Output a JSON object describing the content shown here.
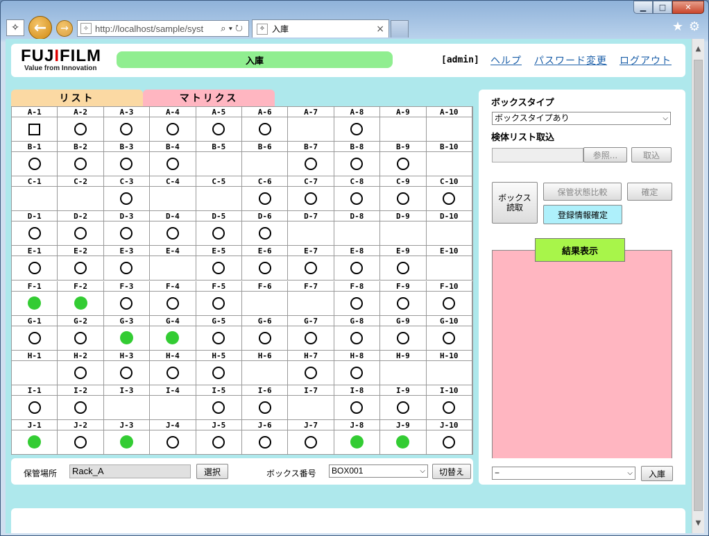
{
  "browser": {
    "url": "http://localhost/sample/syst",
    "tab_title": "入庫",
    "caption": {
      "min": "▁",
      "max": "□",
      "close": "✕"
    }
  },
  "header": {
    "logo_brand": [
      "FUJ",
      "I",
      "FILM"
    ],
    "logo_tagline": "Value from Innovation",
    "title": "入庫",
    "user": "[admin]",
    "links": [
      "ヘルプ",
      "パスワード変更",
      "ログアウト"
    ]
  },
  "tabs": {
    "list": "リスト",
    "matrix": "マトリクス"
  },
  "matrix": {
    "rows": [
      "A",
      "B",
      "C",
      "D",
      "E",
      "F",
      "G",
      "H",
      "I",
      "J"
    ],
    "cols": 10,
    "state": [
      [
        "sq",
        "o",
        "o",
        "o",
        "o",
        "o",
        "",
        "o",
        "",
        ""
      ],
      [
        "o",
        "o",
        "o",
        "o",
        "",
        "",
        "o",
        "o",
        "o",
        ""
      ],
      [
        "",
        "",
        "o",
        "",
        "",
        "o",
        "o",
        "o",
        "o",
        "o"
      ],
      [
        "o",
        "o",
        "o",
        "o",
        "o",
        "o",
        "",
        "",
        "",
        ""
      ],
      [
        "o",
        "o",
        "o",
        "",
        "o",
        "o",
        "o",
        "o",
        "o",
        ""
      ],
      [
        "g",
        "g",
        "o",
        "o",
        "o",
        "",
        "",
        "o",
        "o",
        "o"
      ],
      [
        "o",
        "o",
        "g",
        "g",
        "o",
        "o",
        "o",
        "o",
        "o",
        "o"
      ],
      [
        "",
        "o",
        "o",
        "o",
        "o",
        "",
        "o",
        "o",
        "",
        ""
      ],
      [
        "o",
        "o",
        "",
        "",
        "o",
        "o",
        "",
        "o",
        "o",
        "o"
      ],
      [
        "g",
        "o",
        "g",
        "o",
        "o",
        "o",
        "o",
        "g",
        "g",
        "o"
      ]
    ]
  },
  "bottom": {
    "location_label": "保管場所",
    "location_value": "Rack_A",
    "select_btn": "選択",
    "box_label": "ボックス番号",
    "box_value": "BOX001",
    "switch_btn": "切替え"
  },
  "right": {
    "box_type_label": "ボックスタイプ",
    "box_type_value": "ボックスタイプあり",
    "sample_list_label": "検体リスト取込",
    "browse_btn": "参照...",
    "import_btn": "取込",
    "box_read_btn": [
      "ボックス",
      "読取"
    ],
    "compare_btn": "保管状態比較",
    "confirm_btn": "確定",
    "register_btn": "登録情報確定",
    "result_label": "結果表示",
    "bottom_select": "−",
    "store_btn": "入庫"
  },
  "colors": {
    "bg": "#aee8ec",
    "title_green": "#90ee90",
    "list_tab": "#fbd9a3",
    "matrix_tab": "#ffb6c1",
    "filled": "#33cc33",
    "result_bg": "#ffb6c1",
    "result_label_bg": "#a8f54a",
    "register_btn_bg": "#aef0fb"
  }
}
